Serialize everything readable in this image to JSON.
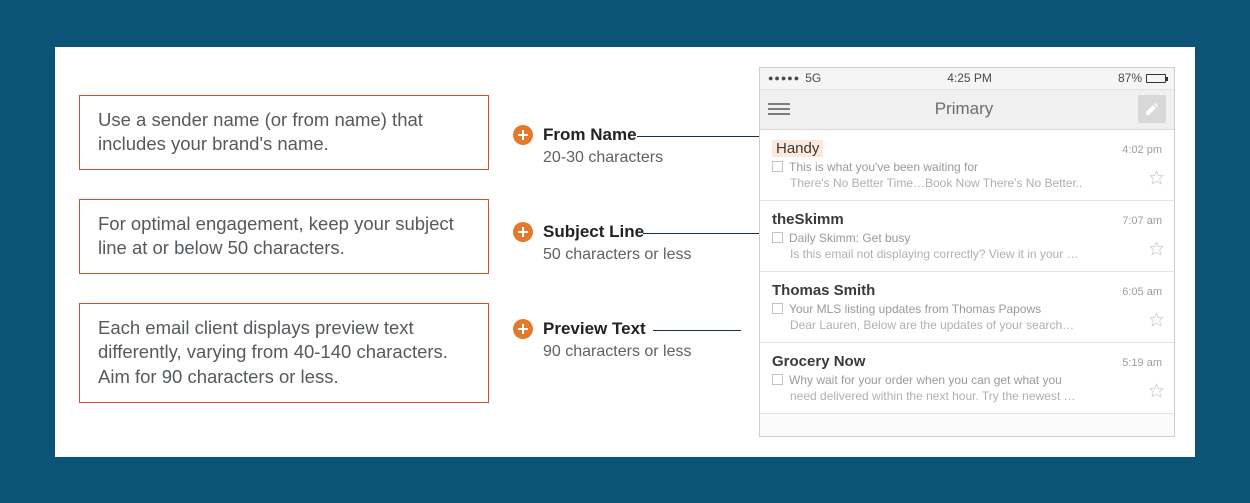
{
  "tips": [
    "Use a sender name (or from name) that includes your brand's name.",
    "For optimal engagement, keep your subject line at or below 50 characters.",
    "Each email client displays preview text differently, varying from 40-140 characters. Aim for 90 characters or less."
  ],
  "callouts": [
    {
      "title": "From Name",
      "sub": "20-30 characters"
    },
    {
      "title": "Subject Line",
      "sub": "50 characters or less"
    },
    {
      "title": "Preview Text",
      "sub": "90 characters or less"
    }
  ],
  "phone": {
    "status": {
      "signal": "●●●●●",
      "carrier": "5G",
      "time": "4:25 PM",
      "battery_pct": "87%"
    },
    "nav_title": "Primary",
    "emails": [
      {
        "sender": "Handy",
        "time": "4:02 pm",
        "subject": "This is what you've been waiting for",
        "preview": "There's No Better Time…Book Now There's No Better.."
      },
      {
        "sender": "theSkimm",
        "time": "7:07 am",
        "subject": "Daily Skimm: Get busy",
        "preview": "Is this email not displaying correctly? View it in your …"
      },
      {
        "sender": "Thomas Smith",
        "time": "6:05 am",
        "subject": "Your MLS listing updates from Thomas Papows",
        "preview": "Dear Lauren, Below are the updates of your search…"
      },
      {
        "sender": "Grocery Now",
        "time": "5:19 am",
        "subject": "Why wait for your order when you can get what you",
        "preview": "need delivered within the next hour. Try the newest …"
      }
    ]
  }
}
